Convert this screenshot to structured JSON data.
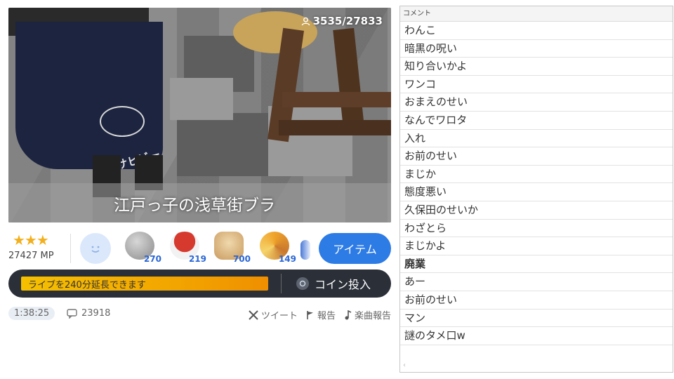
{
  "video": {
    "viewers": "3535/27833",
    "caption": "江戸っ子の浅草街ブラ",
    "apron_text": "アサヒビール"
  },
  "itembar": {
    "stars": "★★★",
    "mp": "27427 MP",
    "gifts": [
      {
        "name": "gift-coin",
        "count": "270",
        "color": "#9a9a9a"
      },
      {
        "name": "gift-sushi",
        "count": "219",
        "color": "#d63a2e"
      },
      {
        "name": "gift-toast",
        "count": "700",
        "color": "#d9b07a"
      },
      {
        "name": "gift-party",
        "count": "149",
        "color": "#c9782d"
      }
    ],
    "item_button": "アイテム"
  },
  "extension": {
    "text": "ライブを240分延長できます",
    "coin_button": "コイン投入"
  },
  "footer": {
    "elapsed": "1:38:25",
    "comment_count": "23918",
    "tweet": "ツイート",
    "report": "報告",
    "music_report": "楽曲報告"
  },
  "comments": {
    "header": "コメント",
    "items": [
      {
        "text": "わんこ",
        "bold": false
      },
      {
        "text": "暗黒の呪い",
        "bold": false
      },
      {
        "text": "知り合いかよ",
        "bold": false
      },
      {
        "text": "ワンコ",
        "bold": false
      },
      {
        "text": "おまえのせい",
        "bold": false
      },
      {
        "text": "なんでワロタ",
        "bold": false
      },
      {
        "text": "入れ",
        "bold": false
      },
      {
        "text": "お前のせい",
        "bold": false
      },
      {
        "text": "まじか",
        "bold": false
      },
      {
        "text": "態度悪い",
        "bold": false
      },
      {
        "text": "久保田のせいか",
        "bold": false
      },
      {
        "text": "わざとら",
        "bold": false
      },
      {
        "text": "まじかよ",
        "bold": false
      },
      {
        "text": "廃業",
        "bold": true
      },
      {
        "text": "あー",
        "bold": false
      },
      {
        "text": "お前のせい",
        "bold": false
      },
      {
        "text": "マン",
        "bold": false
      },
      {
        "text": "謎のタメ口w",
        "bold": false
      }
    ],
    "footer_mark": "‹"
  }
}
